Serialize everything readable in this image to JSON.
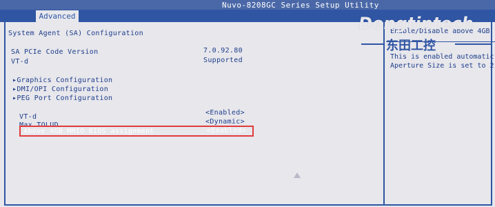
{
  "window": {
    "title": "Nuvo-8208GC Series Setup Utility"
  },
  "tabs": [
    {
      "label": "Advanced"
    }
  ],
  "page": {
    "title": "System Agent (SA) Configuration"
  },
  "info": [
    {
      "label": "SA PCIe Code Version",
      "value": "7.0.92.80"
    },
    {
      "label": "VT-d",
      "value": "Supported"
    }
  ],
  "submenus": [
    {
      "label": "▸Graphics Configuration"
    },
    {
      "label": "▸DMI/OPI Configuration"
    },
    {
      "label": "▸PEG Port Configuration"
    }
  ],
  "settings": [
    {
      "label": "VT-d",
      "value": "<Enabled>"
    },
    {
      "label": "Max TOLUD",
      "value": "<Dynamic>"
    },
    {
      "label": "Above 4GB MMIO BIOS assignment",
      "value": "<Enabled>"
    }
  ],
  "help": {
    "lines": [
      "Enable/Disable above 4GB",
      "This is enabled automatic",
      "Aperture Size is set to 2"
    ]
  },
  "watermark": {
    "brand": "Dongtintech",
    "subtitle": "东田工控"
  },
  "colors": {
    "accent": "#2f55a3",
    "text": "#1e3d8a",
    "background": "#e7e7ec",
    "highlight": "#e23b3b"
  }
}
